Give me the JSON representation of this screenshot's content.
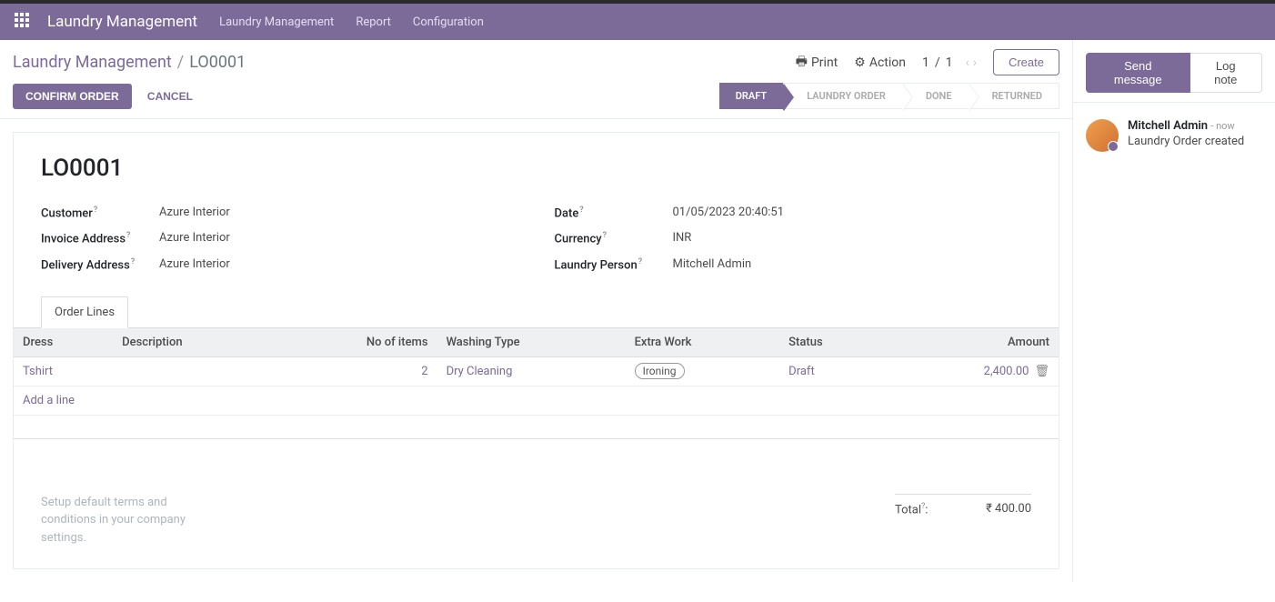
{
  "navbar": {
    "app_title": "Laundry Management",
    "links": [
      "Laundry Management",
      "Report",
      "Configuration"
    ]
  },
  "breadcrumb": {
    "parent": "Laundry Management",
    "sep": "/",
    "current": "LO0001"
  },
  "controls": {
    "print": "Print",
    "action": "Action",
    "pager_current": "1",
    "pager_sep": "/",
    "pager_total": "1",
    "create": "Create"
  },
  "actions": {
    "confirm": "CONFIRM ORDER",
    "cancel": "CANCEL"
  },
  "status_steps": [
    "DRAFT",
    "LAUNDRY ORDER",
    "DONE",
    "RETURNED"
  ],
  "active_status_index": 0,
  "record": {
    "title": "LO0001",
    "left_fields": [
      {
        "label": "Customer",
        "value": "Azure Interior"
      },
      {
        "label": "Invoice Address",
        "value": "Azure Interior"
      },
      {
        "label": "Delivery Address",
        "value": "Azure Interior"
      }
    ],
    "right_fields": [
      {
        "label": "Date",
        "value": "01/05/2023 20:40:51"
      },
      {
        "label": "Currency",
        "value": "INR"
      },
      {
        "label": "Laundry Person",
        "value": "Mitchell Admin"
      }
    ]
  },
  "tabs": {
    "order_lines": "Order Lines"
  },
  "table": {
    "headers": {
      "dress": "Dress",
      "description": "Description",
      "no_items": "No of items",
      "washing_type": "Washing Type",
      "extra_work": "Extra Work",
      "status": "Status",
      "amount": "Amount"
    },
    "rows": [
      {
        "dress": "Tshirt",
        "description": "",
        "no_items": "2",
        "washing_type": "Dry Cleaning",
        "extra_work": "Ironing",
        "status": "Draft",
        "amount": "2,400.00"
      }
    ],
    "add_line": "Add a line"
  },
  "footer": {
    "terms_placeholder": "Setup default terms and conditions in your company settings.",
    "total_label": "Total",
    "total_suffix": ":",
    "total_value": "₹ 400.00"
  },
  "chatter": {
    "send": "Send message",
    "log": "Log note",
    "author": "Mitchell Admin",
    "time_prefix": "- ",
    "time": "now",
    "message": "Laundry Order created"
  }
}
